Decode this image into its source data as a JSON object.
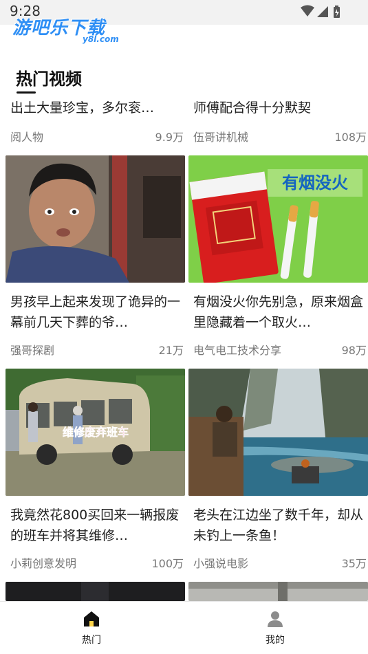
{
  "status_bar": {
    "time": "9:28"
  },
  "watermark": {
    "main": "游吧乐下载",
    "sub": "y8l.com"
  },
  "section": {
    "title": "热门视频"
  },
  "videos": [
    {
      "title": "出土大量珍宝，多尔衮…",
      "author": "阅人物",
      "views": "9.9万"
    },
    {
      "title": "师傅配合得十分默契",
      "author": "伍哥讲机械",
      "views": "108万"
    },
    {
      "title": "男孩早上起来发现了诡异的一幕前几天下葬的爷…",
      "author": "强哥探剧",
      "views": "21万"
    },
    {
      "title": "有烟没火你先别急，原来烟盒里隐藏着一个取火…",
      "author": "电气电工技术分享",
      "views": "98万",
      "thumb_caption": "有烟没火"
    },
    {
      "title": "我竟然花800买回来一辆报废的班车并将其维修…",
      "author": "小莉创意发明",
      "views": "100万",
      "thumb_caption": "维修废弃班车"
    },
    {
      "title": "老头在江边坐了数千年，却从未钓上一条鱼！",
      "author": "小强说电影",
      "views": "35万"
    }
  ],
  "tabs": [
    {
      "label": "热门",
      "icon": "home-icon",
      "active": true
    },
    {
      "label": "我的",
      "icon": "user-icon",
      "active": false
    }
  ],
  "colors": {
    "watermark": "#2f8ff5",
    "thumb_caption": "#1565c0",
    "accent": "#111111"
  }
}
